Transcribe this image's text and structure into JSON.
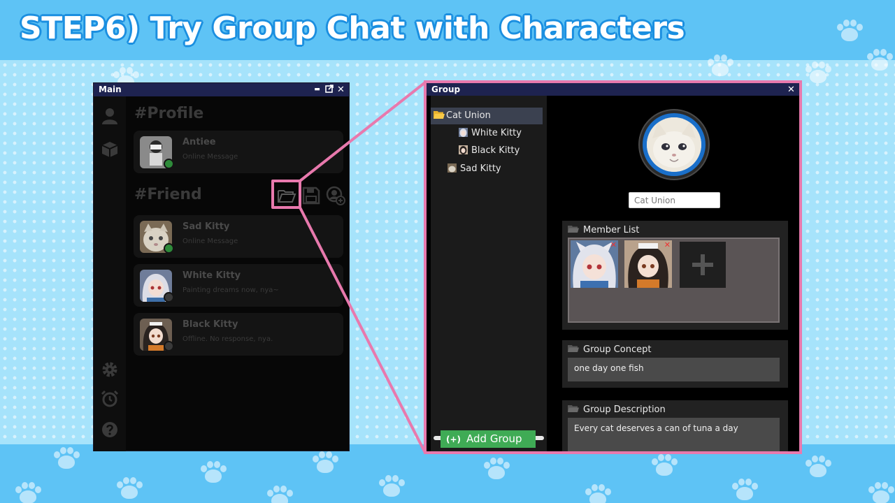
{
  "banner": {
    "title": "STEP6) Try Group Chat with Characters"
  },
  "main_window": {
    "title": "Main",
    "controls": {
      "popout": "⇱",
      "close": "✕",
      "minimize": "▬"
    },
    "profile_heading": "#Profile",
    "profile": {
      "name": "Antiee",
      "message": "Online Message",
      "status_color": "#2e8b3a"
    },
    "friend_heading": "#Friend",
    "friends": [
      {
        "name": "Sad Kitty",
        "message": "Online Message",
        "status_color": "#2e8b3a"
      },
      {
        "name": "White Kitty",
        "message": "Painting dreams now, nya~",
        "status_color": "#3a3a3a"
      },
      {
        "name": "Black Kitty",
        "message": "Offline. No response, nya.",
        "status_color": "#3a3a3a"
      }
    ]
  },
  "group_window": {
    "title": "Group",
    "close": "✕",
    "tree": [
      {
        "label": "Cat Union",
        "icon": "folder-open-icon",
        "selected": true
      },
      {
        "label": "White Kitty",
        "icon": "white-kitty-avatar-icon"
      },
      {
        "label": "Black Kitty",
        "icon": "black-kitty-avatar-icon"
      },
      {
        "label": "Sad Kitty",
        "icon": "sad-kitty-avatar-icon"
      }
    ],
    "add_group": {
      "plus": "(+)",
      "label": "Add Group"
    },
    "group_name_value": "Cat Union",
    "member_list_heading": "Member List",
    "remove_glyph": "✕",
    "group_concept_heading": "Group Concept",
    "group_concept_value": "one day one fish",
    "group_description_heading": "Group Description",
    "group_description_value": "Every cat deserves a can of tuna a day"
  },
  "colors": {
    "highlight": "#e879ad",
    "titlebar": "#1e2350",
    "add_group": "#3fab55",
    "background_top": "#5ec3f5",
    "background_mid": "#a6e3fb"
  }
}
